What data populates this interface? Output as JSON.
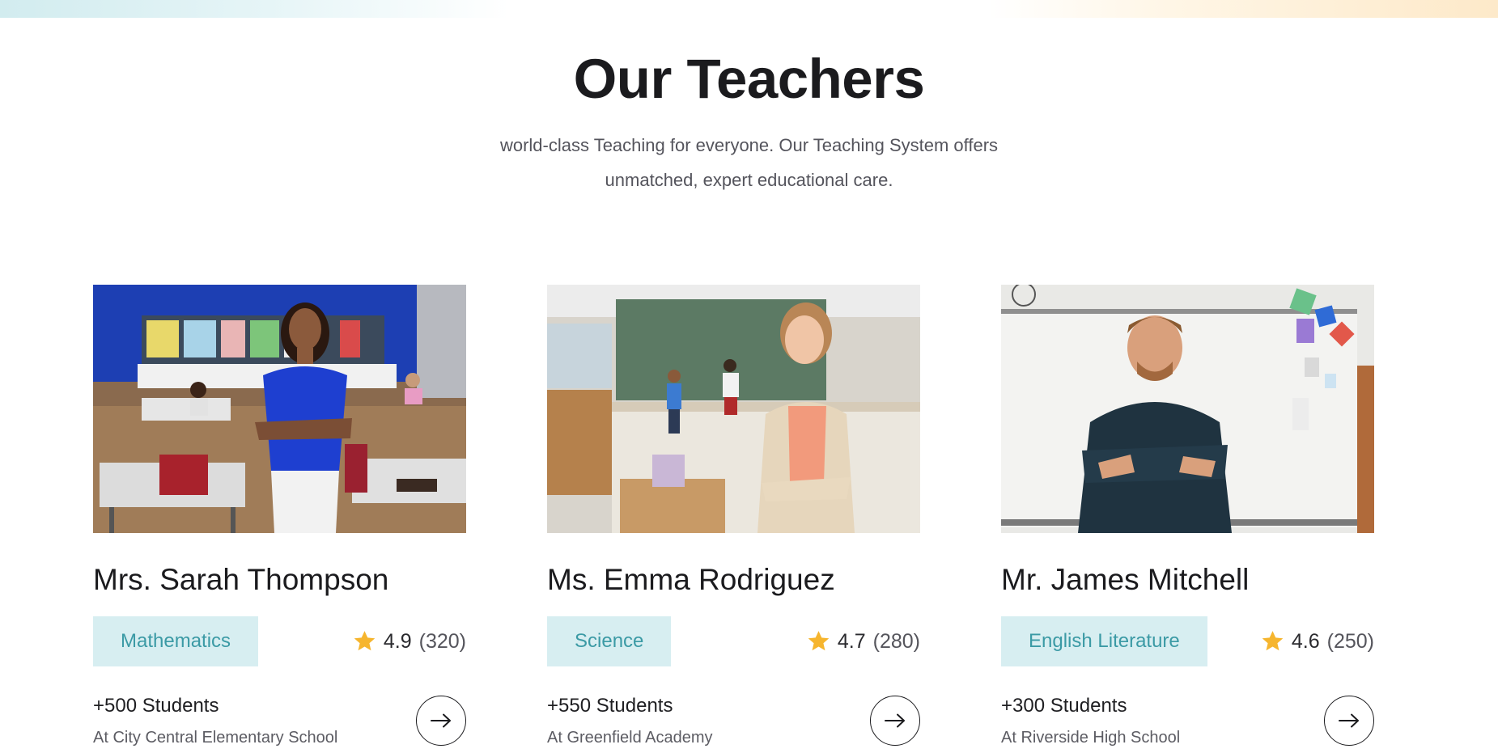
{
  "section": {
    "title": "Our Teachers",
    "subtitle_line1": "world-class Teaching for everyone. Our Teaching System offers",
    "subtitle_line2": "unmatched, expert educational care."
  },
  "teachers": [
    {
      "name": "Mrs. Sarah Thompson",
      "subject": "Mathematics",
      "rating": "4.9",
      "reviews": "(320)",
      "students": "+500 Students",
      "school": "At City Central Elementary School",
      "photo_icon": "teacher-photo-classroom-blue-wall"
    },
    {
      "name": "Ms. Emma Rodriguez",
      "subject": "Science",
      "rating": "4.7",
      "reviews": "(280)",
      "students": "+550 Students",
      "school": "At Greenfield Academy",
      "photo_icon": "teacher-photo-chalkboard"
    },
    {
      "name": "Mr. James Mitchell",
      "subject": "English Literature",
      "rating": "4.6",
      "reviews": "(250)",
      "students": "+300 Students",
      "school": "At Riverside High School",
      "photo_icon": "teacher-photo-whiteboard"
    }
  ],
  "icons": {
    "star": "star-icon",
    "arrow": "arrow-right-icon"
  },
  "colors": {
    "subject_bg": "#d7eef1",
    "subject_text": "#3b9aa5",
    "star": "#f6b52e",
    "heading": "#1b1b1e"
  }
}
